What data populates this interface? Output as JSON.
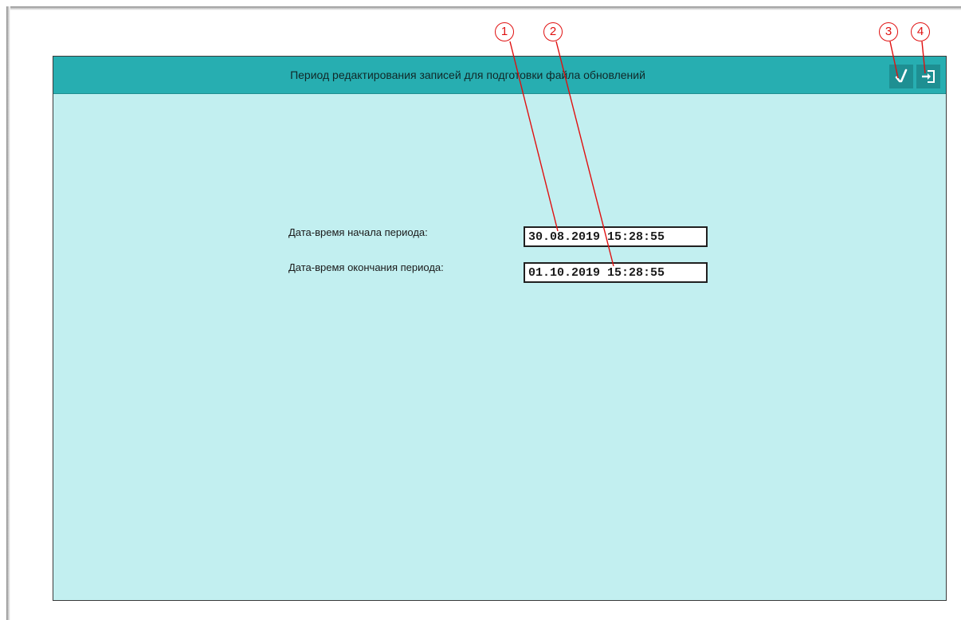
{
  "window": {
    "title": "Период редактирования записей для подготовки файла обновлений",
    "accent_color": "#27aeb1",
    "body_color": "#c2eff0",
    "buttons": {
      "apply_icon": "checkmark-icon",
      "exit_icon": "exit-door-icon"
    }
  },
  "form": {
    "start_label": "Дата-время начала периода:",
    "start_value": "30.08.2019 15:28:55",
    "end_label": "Дата-время окончания периода:",
    "end_value": "01.10.2019 15:28:55"
  },
  "callouts": [
    "1",
    "2",
    "3",
    "4"
  ],
  "callout_color": "#e01010"
}
